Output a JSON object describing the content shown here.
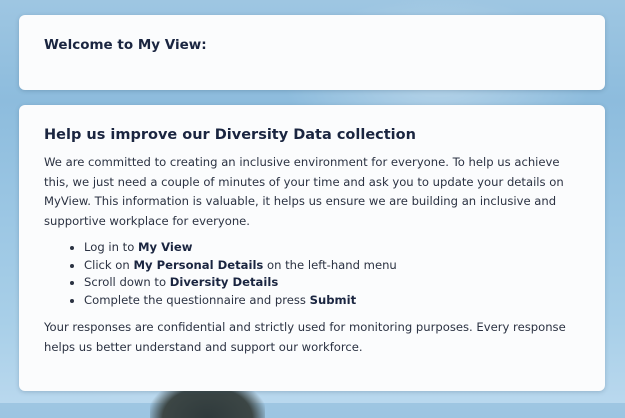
{
  "welcome": {
    "title": "Welcome to My View:"
  },
  "diversity": {
    "title": "Help us improve our Diversity Data collection",
    "intro": "We are committed to creating an inclusive environment for everyone. To help us achieve this, we just need a couple of minutes of your time and ask you to update your details on MyView. This information is valuable, it helps us ensure we are building an inclusive and supportive workplace for everyone.",
    "steps": [
      {
        "before": "Log in to ",
        "strong": "My View",
        "after": ""
      },
      {
        "before": "Click on ",
        "strong": "My Personal Details",
        "after": " on the left-hand menu"
      },
      {
        "before": "Scroll down to ",
        "strong": "Diversity Details",
        "after": ""
      },
      {
        "before": "Complete the questionnaire and press ",
        "strong": "Submit",
        "after": ""
      }
    ],
    "outro": "Your responses are confidential and strictly used for monitoring purposes. Every response helps us better understand and support our workforce."
  },
  "colors": {
    "card_background": "#fbfcfd",
    "heading_text": "#1a2540",
    "body_text": "#2b3242",
    "sky_background": "#9ec6e2"
  }
}
